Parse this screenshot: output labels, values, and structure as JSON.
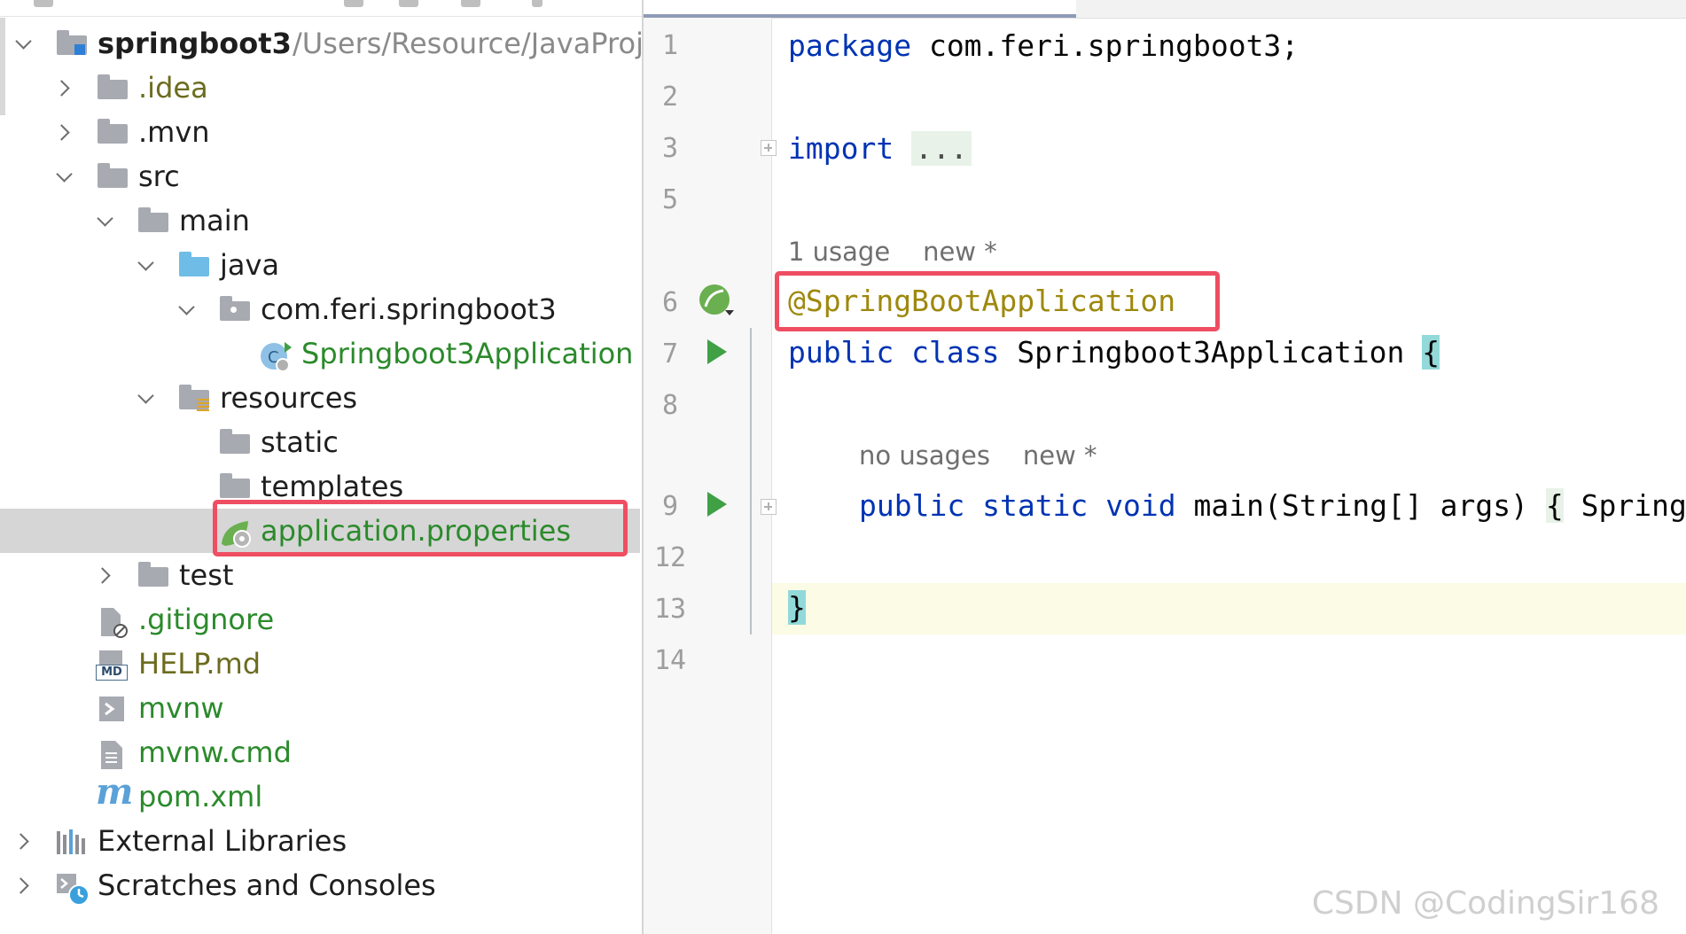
{
  "tree": {
    "project_name": "springboot3",
    "project_path": "/Users/Resource/JavaProj",
    "items": [
      {
        "label": ".idea"
      },
      {
        "label": ".mvn"
      },
      {
        "label": "src"
      },
      {
        "label": "main"
      },
      {
        "label": "java"
      },
      {
        "label": "com.feri.springboot3"
      },
      {
        "label": "Springboot3Application"
      },
      {
        "label": "resources"
      },
      {
        "label": "static"
      },
      {
        "label": "templates"
      },
      {
        "label": "application.properties"
      },
      {
        "label": "test"
      },
      {
        "label": ".gitignore"
      },
      {
        "label": "HELP.md"
      },
      {
        "label": "mvnw"
      },
      {
        "label": "mvnw.cmd"
      },
      {
        "label": "pom.xml"
      },
      {
        "label": "External Libraries"
      },
      {
        "label": "Scratches and Consoles"
      }
    ],
    "md_badge": "MD",
    "pom_glyph": "m"
  },
  "editor": {
    "line_numbers": [
      "1",
      "2",
      "3",
      "5",
      "6",
      "7",
      "8",
      "9",
      "12",
      "13",
      "14"
    ],
    "code": {
      "pkg_kw": "package",
      "pkg_name": " com.feri.springboot3;",
      "import_kw": "import",
      "import_dots": "...",
      "hint1_usage": "1 usage",
      "hint1_new": "new *",
      "annotation": "@SpringBootApplication",
      "class_kw1": "public",
      "class_kw2": "class",
      "class_name": " Springboot3Application ",
      "class_brace": "{",
      "hint2_usage": "no usages",
      "hint2_new": "new *",
      "main_kw1": "public",
      "main_kw2": "static",
      "main_kw3": "void",
      "main_sig": " main(String[] args) ",
      "main_brace": "{",
      "main_rest": " Spring",
      "close_brace": "}"
    }
  },
  "watermark": "CSDN @CodingSir168",
  "colors": {
    "highlight_box": "#ef4e62",
    "keyword": "#0033b3",
    "annotation": "#9e880d",
    "run_icon": "#3fa046"
  }
}
